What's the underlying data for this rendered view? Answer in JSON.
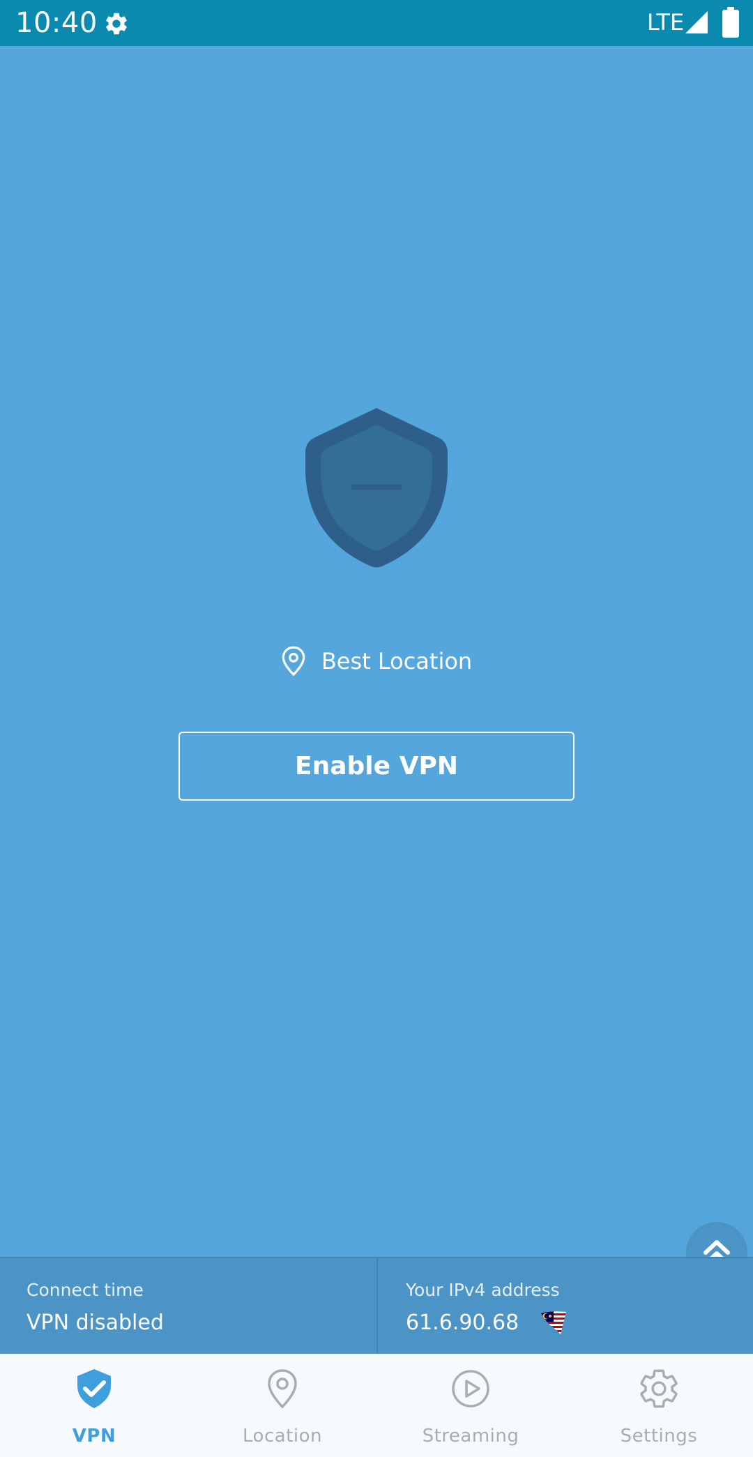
{
  "status_bar": {
    "time": "10:40",
    "network": "LTE",
    "icons": [
      "settings-gear-icon",
      "signal-icon",
      "battery-icon"
    ]
  },
  "main": {
    "shield_icon": "shield-disabled-icon",
    "location_label": "Best Location",
    "enable_button_label": "Enable VPN",
    "expand_icon": "double-chevron-up-icon"
  },
  "info_panel": {
    "connect_time_label": "Connect time",
    "connect_time_value": "VPN disabled",
    "ip_label": "Your IPv4 address",
    "ip_value": "61.6.90.68",
    "flag_icon": "malaysia-flag-icon"
  },
  "bottom_nav": {
    "items": [
      {
        "label": "VPN",
        "icon": "shield-check-icon",
        "active": true
      },
      {
        "label": "Location",
        "icon": "map-pin-icon",
        "active": false
      },
      {
        "label": "Streaming",
        "icon": "play-circle-icon",
        "active": false
      },
      {
        "label": "Settings",
        "icon": "gear-icon",
        "active": false
      }
    ]
  },
  "colors": {
    "status_bar": "#0B8AAF",
    "background": "#55A6DC",
    "shield_outer": "#2E5F8A",
    "shield_inner": "#336E98",
    "info_panel": "#4C93C6",
    "nav_active": "#3E9FDC",
    "nav_inactive": "#A7ADB2"
  }
}
